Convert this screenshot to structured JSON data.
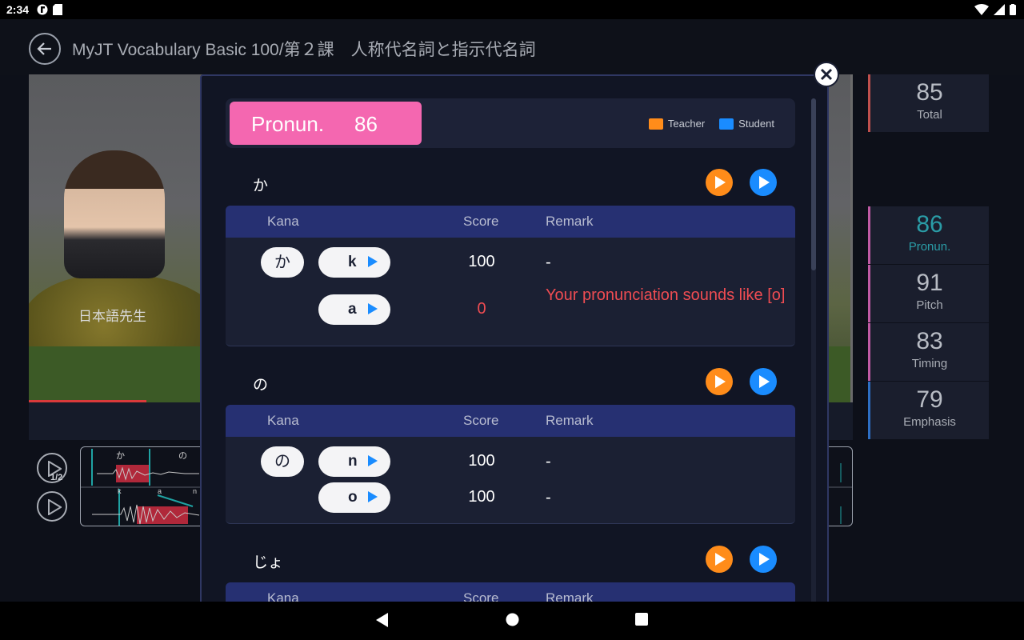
{
  "status_bar": {
    "time": "2:34"
  },
  "header": {
    "title": "MyJT Vocabulary Basic 100/第２課　人称代名詞と指示代名詞"
  },
  "stage": {
    "teacher_name": "日本語先生",
    "speed_label": "1/2",
    "wave_top_labels": [
      "か",
      "の"
    ],
    "wave_bottom_labels": [
      "k",
      "a",
      "n"
    ]
  },
  "scores": [
    {
      "value": "85",
      "label": "Total",
      "accent": "#c0504d"
    },
    {
      "value": "86",
      "label": "Pronun.",
      "accent": "#c05aa4"
    },
    {
      "value": "91",
      "label": "Pitch",
      "accent": "#c05aa4"
    },
    {
      "value": "83",
      "label": "Timing",
      "accent": "#c05aa4"
    },
    {
      "value": "79",
      "label": "Emphasis",
      "accent": "#2d6fc4"
    }
  ],
  "modal": {
    "pronun_label": "Pronun.",
    "pronun_value": "86",
    "legend": {
      "teacher": "Teacher",
      "student": "Student",
      "teacher_color": "#ff8c1a",
      "student_color": "#1a8cff"
    },
    "table_headers": {
      "kana": "Kana",
      "score": "Score",
      "remark": "Remark"
    },
    "sections": [
      {
        "title": "か",
        "rows": [
          {
            "kana": "か",
            "phoneme": "k",
            "score": "100",
            "remark": "-"
          },
          {
            "kana": "",
            "phoneme": "a",
            "score": "0",
            "remark": "Your pronunciation sounds like [o]"
          }
        ]
      },
      {
        "title": "の",
        "rows": [
          {
            "kana": "の",
            "phoneme": "n",
            "score": "100",
            "remark": "-"
          },
          {
            "kana": "",
            "phoneme": "o",
            "score": "100",
            "remark": "-"
          }
        ]
      },
      {
        "title": "じょ",
        "rows": []
      }
    ]
  },
  "colors": {
    "pronun_pill": "#f467b0",
    "error_red": "#ef4c52",
    "table_header": "#263072",
    "teacher_orange": "#ff8c1a",
    "student_blue": "#1a8cff"
  }
}
